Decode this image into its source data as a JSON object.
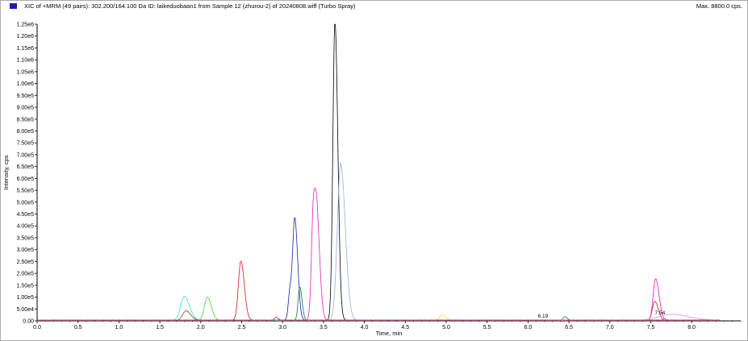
{
  "header": {
    "title": "XIC of +MRM (49 pairs): 302.200/164.100 Da ID: laikeduobaan1 from Sample 12 (zhurou-2) of 20240808.wiff (Turbo Spray)",
    "max_info": "Max. 8800.0 cps.",
    "legend_color": "#1c1cb4"
  },
  "chart_data": {
    "type": "line",
    "xlabel": "Time, min",
    "ylabel": "Intensity, cps",
    "xlim": [
      0.0,
      8.6
    ],
    "ylim": [
      0,
      1250000
    ],
    "x_ticks": [
      "0.0",
      "0.5",
      "1.0",
      "1.5",
      "2.0",
      "2.5",
      "3.0",
      "3.5",
      "4.0",
      "4.5",
      "5.0",
      "5.5",
      "6.0",
      "6.5",
      "7.0",
      "7.5",
      "8.0"
    ],
    "y_ticks": [
      "0.00",
      "5.00e4",
      "1.00e5",
      "1.50e5",
      "2.00e5",
      "2.50e5",
      "3.00e5",
      "3.50e5",
      "4.00e5",
      "4.50e5",
      "5.00e5",
      "5.50e5",
      "6.00e5",
      "6.50e5",
      "7.00e5",
      "7.50e5",
      "8.00e5",
      "8.50e5",
      "9.00e5",
      "9.50e5",
      "1.00e6",
      "1.05e6",
      "1.10e6",
      "1.15e6",
      "1.20e6",
      "1.25e6"
    ],
    "peak_annotations": [
      {
        "text": "6.19",
        "x": 6.12,
        "y": 6000
      },
      {
        "text": "7.54",
        "x": 7.55,
        "y": 20000
      }
    ],
    "series": [
      {
        "color": "#000000",
        "peaks": [
          {
            "rt": 3.64,
            "height": 1260000,
            "width": 0.025
          }
        ]
      },
      {
        "color": "#9aaed4",
        "peaks": [
          {
            "rt": 3.71,
            "height": 660000,
            "width": 0.04
          }
        ]
      },
      {
        "color": "#e01fc0",
        "peaks": [
          {
            "rt": 3.38,
            "height": 500000,
            "width": 0.025
          },
          {
            "rt": 3.43,
            "height": 270000,
            "width": 0.025
          }
        ]
      },
      {
        "color": "#1c1cb4",
        "peaks": [
          {
            "rt": 3.15,
            "height": 420000,
            "width": 0.025
          },
          {
            "rt": 3.09,
            "height": 120000,
            "width": 0.02
          }
        ]
      },
      {
        "color": "#d11b1b",
        "peaks": [
          {
            "rt": 2.49,
            "height": 250000,
            "width": 0.03
          },
          {
            "rt": 7.55,
            "height": 80000,
            "width": 0.03
          }
        ]
      },
      {
        "color": "#0b7a3a",
        "peaks": [
          {
            "rt": 3.21,
            "height": 140000,
            "width": 0.02
          }
        ]
      },
      {
        "color": "#40d440",
        "peaks": [
          {
            "rt": 2.08,
            "height": 98000,
            "width": 0.035
          }
        ]
      },
      {
        "color": "#3fcfcf",
        "peaks": [
          {
            "rt": 1.8,
            "height": 100000,
            "width": 0.045
          }
        ]
      },
      {
        "color": "#8a5a2b",
        "peaks": [
          {
            "rt": 1.82,
            "height": 40000,
            "width": 0.04
          }
        ]
      },
      {
        "color": "#d01ed0",
        "peaks": [
          {
            "rt": 7.56,
            "height": 175000,
            "width": 0.03
          }
        ]
      },
      {
        "color": "#e59ae0",
        "peaks": [
          {
            "rt": 7.75,
            "height": 25000,
            "width": 0.15
          }
        ]
      },
      {
        "color": "#e8e03a",
        "peaks": [
          {
            "rt": 4.95,
            "height": 22000,
            "width": 0.03
          }
        ]
      },
      {
        "color": "#2f7f7f",
        "peaks": [
          {
            "rt": 6.45,
            "height": 15000,
            "width": 0.02
          }
        ]
      },
      {
        "color": "#b0305a",
        "peaks": [
          {
            "rt": 2.92,
            "height": 12000,
            "width": 0.02
          }
        ]
      }
    ]
  }
}
